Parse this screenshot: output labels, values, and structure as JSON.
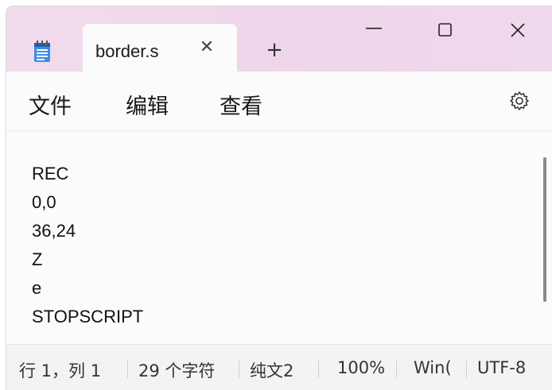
{
  "tab": {
    "title": "border.s",
    "close_glyph": "✕",
    "new_tab_glyph": "+"
  },
  "window_controls": {
    "minimize": "—",
    "maximize": "☐",
    "close": "✕"
  },
  "menu": {
    "items": [
      "文件",
      "编辑",
      "查看"
    ]
  },
  "editor": {
    "lines": [
      "REC",
      "0,0",
      "36,24",
      "Z",
      "e",
      "STOPSCRIPT"
    ]
  },
  "status": {
    "position": "行 1，列 1",
    "chars": "29 个字符",
    "format": "纯文2",
    "zoom": "100%",
    "line_ending": "Win(",
    "encoding": "UTF-8"
  },
  "icons": {
    "app": "notepad-icon",
    "settings": "gear-icon"
  },
  "colors": {
    "titlebar": "#efd5ea",
    "icon_accent": "#2e7cd6"
  }
}
